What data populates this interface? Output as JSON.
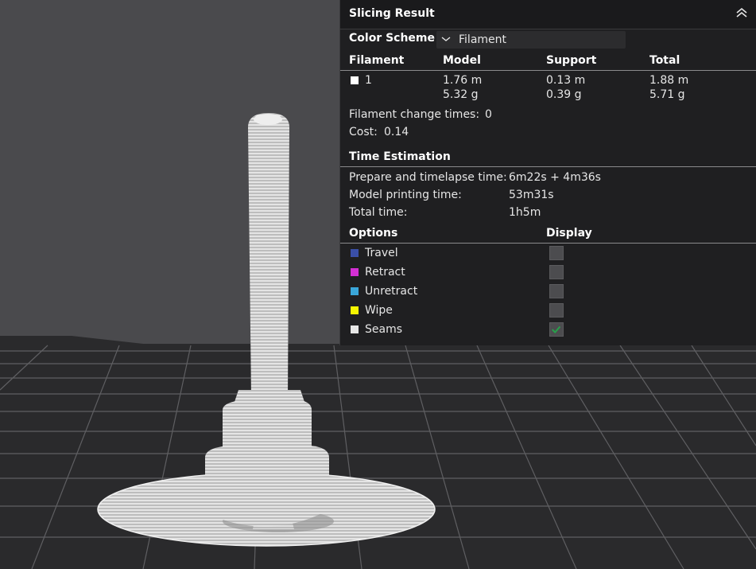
{
  "panel": {
    "title": "Slicing Result",
    "color_scheme_label": "Color Scheme",
    "color_scheme_value": "Filament",
    "table": {
      "headers": [
        "Filament",
        "Model",
        "Support",
        "Total"
      ],
      "row": {
        "filament_id": "1",
        "model_length": "1.76 m",
        "model_weight": "5.32 g",
        "support_length": "0.13 m",
        "support_weight": "0.39 g",
        "total_length": "1.88 m",
        "total_weight": "5.71 g"
      }
    },
    "filament_change_label": "Filament change times:",
    "filament_change_value": "0",
    "cost_label": "Cost:",
    "cost_value": "0.14",
    "time_header": "Time Estimation",
    "prepare_label": "Prepare and timelapse time:",
    "prepare_value": "6m22s + 4m36s",
    "model_time_label": "Model printing time:",
    "model_time_value": "53m31s",
    "total_time_label": "Total time:",
    "total_time_value": "1h5m",
    "options_header": "Options",
    "display_header": "Display",
    "options": [
      {
        "label": "Travel",
        "color": "#3a4fa8",
        "checked": false
      },
      {
        "label": "Retract",
        "color": "#d42fd4",
        "checked": false
      },
      {
        "label": "Unretract",
        "color": "#3aa6d9",
        "checked": false
      },
      {
        "label": "Wipe",
        "color": "#f5f500",
        "checked": false
      },
      {
        "label": "Seams",
        "color": "#e6e6e6",
        "checked": true
      }
    ]
  },
  "colors": {
    "viewport_bg": "#4a4a4d",
    "plate": "#2a2a2c",
    "grid": "#5f5f62",
    "model": "#cfcfcf",
    "check": "#27a04a"
  }
}
